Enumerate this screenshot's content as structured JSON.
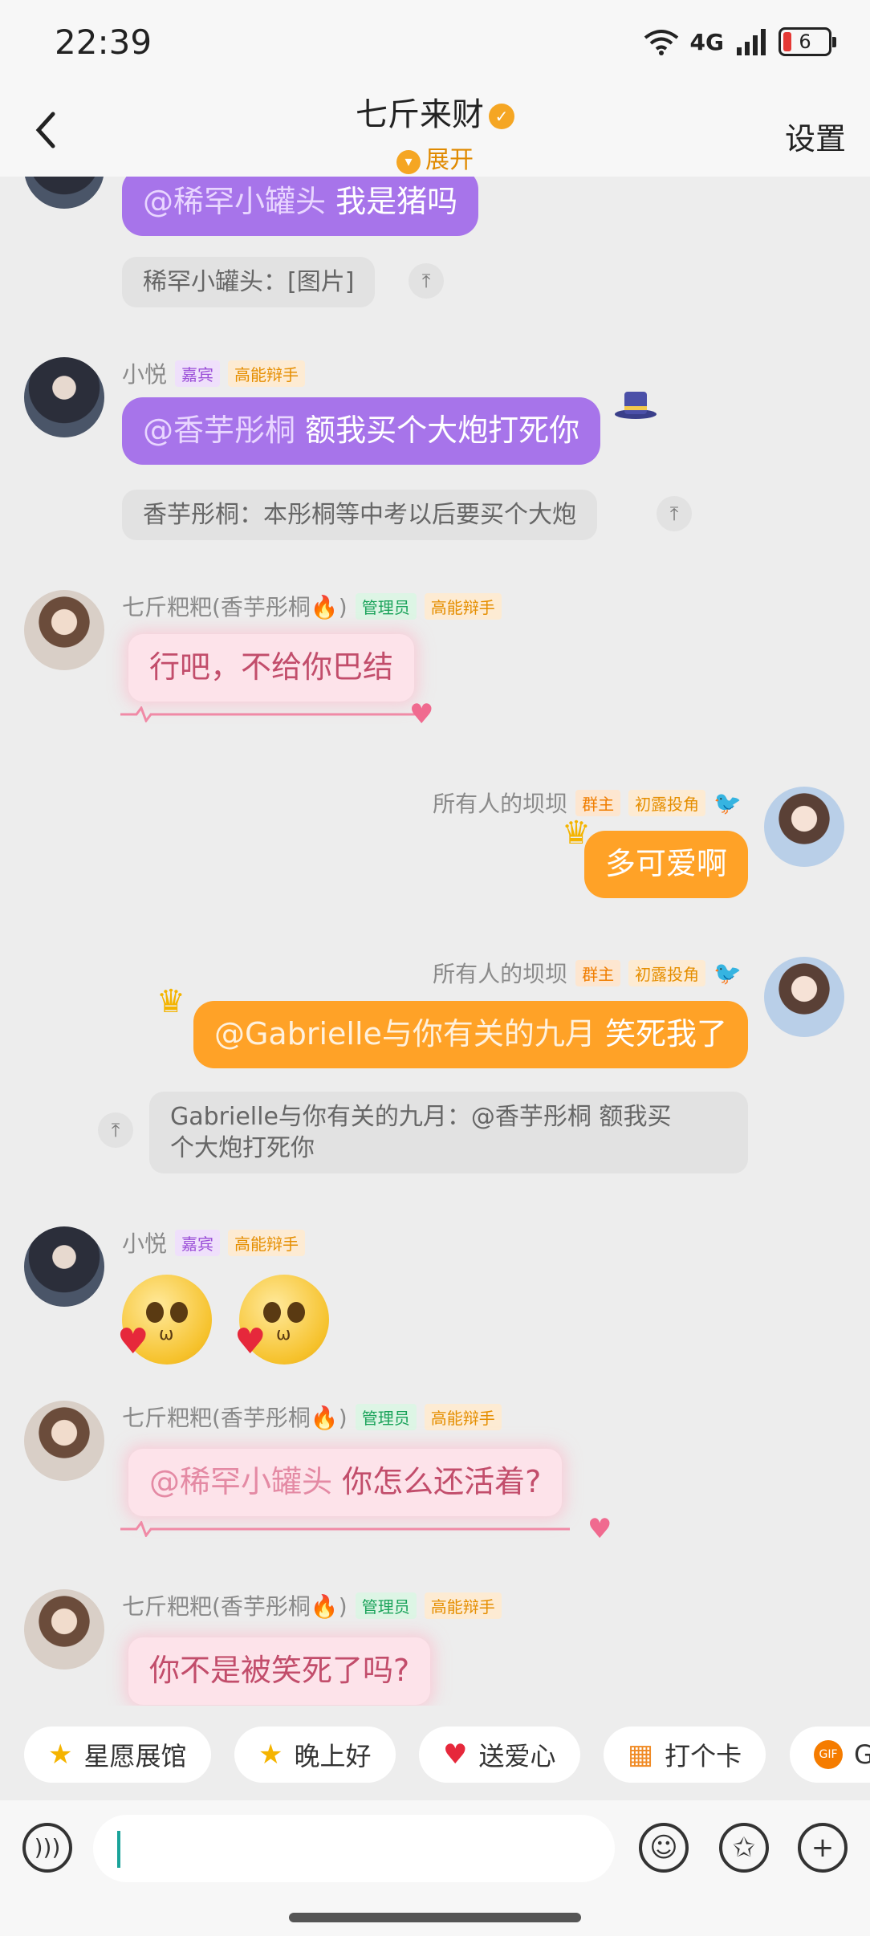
{
  "status_bar": {
    "time": "22:39",
    "network": "4G",
    "battery": "6"
  },
  "header": {
    "title": "七斤来财",
    "expand": "展开",
    "settings": "设置"
  },
  "messages": {
    "m1": {
      "at": "@稀罕小罐头",
      "text": " 我是猪吗",
      "quote": "稀罕小罐头：[图片]"
    },
    "m2": {
      "name": "小悦",
      "tag1": "嘉宾",
      "tag2": "高能辩手",
      "at": "@香芋彤桐",
      "text": " 额我买个大炮打死你",
      "quote": "香芋彤桐：本彤桐等中考以后要买个大炮"
    },
    "m3": {
      "name": "七斤粑粑(香芋彤桐🔥)",
      "tag1": "管理员",
      "tag2": "高能辩手",
      "text": "行吧，不给你巴结"
    },
    "m4": {
      "name": "所有人的坝坝",
      "tag1": "群主",
      "tag2": "初露投角",
      "text": "多可爱啊"
    },
    "m5": {
      "name": "所有人的坝坝",
      "tag1": "群主",
      "tag2": "初露投角",
      "at": "@Gabrielle与你有关的九月",
      "text": " 笑死我了",
      "quote_line1": "Gabrielle与你有关的九月：@香芋彤桐 额我买",
      "quote_line2": "个大炮打死你"
    },
    "m6": {
      "name": "小悦",
      "tag1": "嘉宾",
      "tag2": "高能辩手"
    },
    "m7": {
      "name": "七斤粑粑(香芋彤桐🔥)",
      "tag1": "管理员",
      "tag2": "高能辩手",
      "at": "@稀罕小罐头",
      "text": " 你怎么还活着?"
    },
    "m8": {
      "name": "七斤粑粑(香芋彤桐🔥)",
      "tag1": "管理员",
      "tag2": "高能辩手",
      "text": "你不是被笑死了吗?"
    }
  },
  "quick_actions": [
    "星愿展馆",
    "晚上好",
    "送爱心",
    "打个卡",
    "G"
  ],
  "quick_icons": [
    "star-icon",
    "star-face-icon",
    "heart-icon",
    "calendar-icon",
    "gif-icon"
  ],
  "colors": {
    "purple": "#a774ea",
    "orange": "#ffa227",
    "pink": "#fde3ea"
  }
}
